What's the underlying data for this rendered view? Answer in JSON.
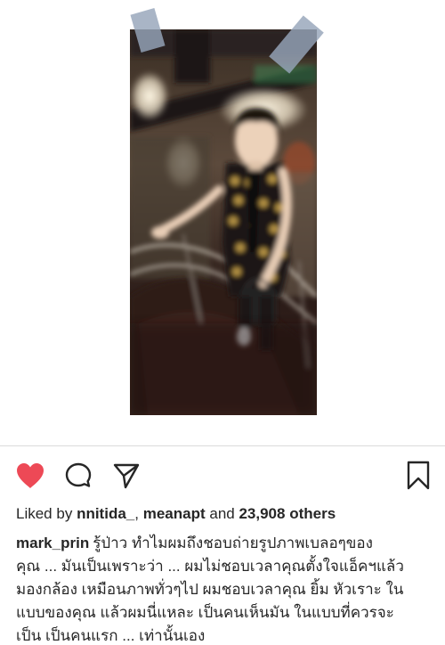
{
  "post": {
    "actions": {
      "liked": true,
      "heart_color": "#ed4956"
    },
    "likes": {
      "prefix": "Liked by",
      "user1": "nnitida_",
      "separator": ",",
      "user2": "meanapt",
      "conjunction": "and",
      "count": "23,908 others"
    },
    "caption": {
      "username": "mark_prin",
      "lines": [
        "รู้ป่าว ทำไมผมถึงชอบถ่ายรูปภาพเบลอๆของ",
        "คุณ ... มันเป็นเพราะว่า ... ผมไม่ชอบเวลาคุณตั้งใจแอ็คฯแล้ว",
        "มองกล้อง เหมือนภาพทั่วๆไป ผมชอบเวลาคุณ ยิ้ม หัวเราะ ใน",
        "แบบของคุณ แล้วผมนี่แหละ เป็นคนเห็นมัน ในแบบที่ควรจะ",
        "เป็น เป็นคนแรก ... เท่านั้นเอง"
      ]
    }
  }
}
